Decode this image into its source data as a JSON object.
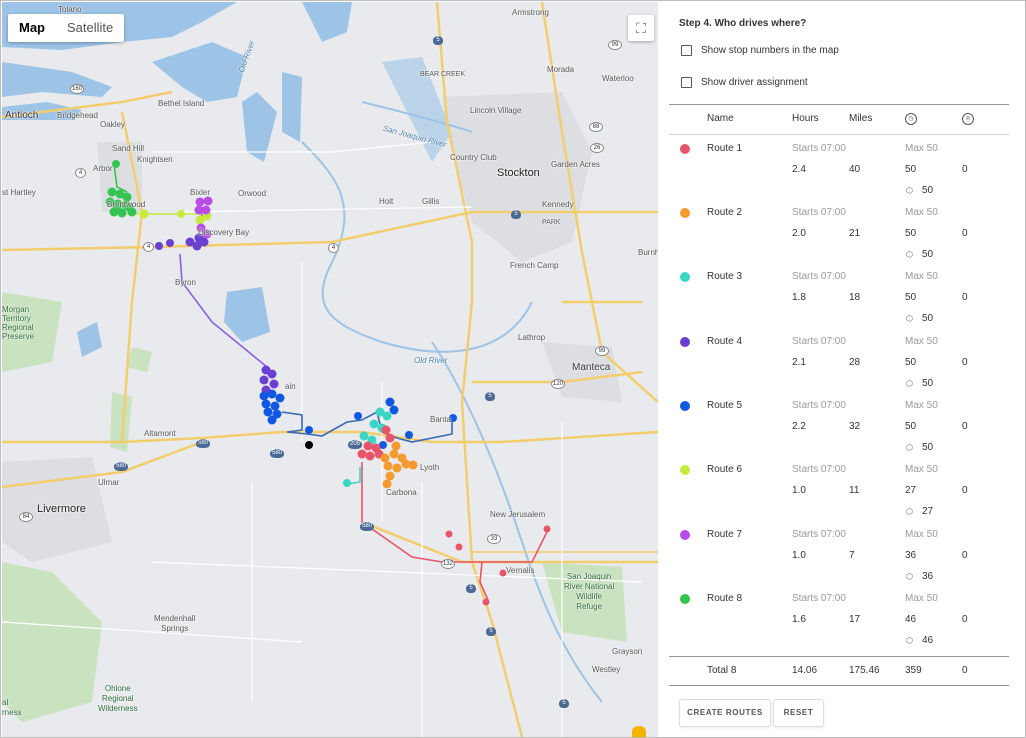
{
  "map": {
    "type_buttons": [
      "Map",
      "Satellite"
    ],
    "active_type": "Map",
    "fullscreen_icon": "⛶",
    "labels": {
      "tolano": "Tolano",
      "armstrong": "Armstrong",
      "morada": "Morada",
      "waterloo": "Waterloo",
      "bear_creek": "BEAR CREEK",
      "antioch": "Antioch",
      "bridgehead": "Bridgehead",
      "oakley": "Oakley",
      "bethel_island": "Bethel Island",
      "lincoln_village": "Lincoln Village",
      "sand_hill": "Sand Hill",
      "knightsen": "Knightsen",
      "arbor": "Arbor",
      "country_club": "Country Club",
      "stockton": "Stockton",
      "garden_acres": "Garden Acres",
      "east_hartley": "st Hartley",
      "brentwood": "Brentwood",
      "bixler": "Bixler",
      "orwood": "Orwood",
      "holt": "Holt",
      "gillis": "Gillis",
      "kennedy": "Kennedy",
      "discovery_bay": "Discovery Bay",
      "park": "PARK",
      "burnham": "Burnh",
      "french_camp": "French Camp",
      "byron": "Byron",
      "morgan_territory": "Morgan\nTerritory\nRegional\nPreserve",
      "lathrop": "Lathrop",
      "old_river": "Old River",
      "manteca": "Manteca",
      "mountain_house": "ain",
      "bantas": "Banta",
      "altamont": "Altamont",
      "lyoth": "Lyoth",
      "carbona": "Carbona",
      "ulmar": "Ulmar",
      "livermore": "Livermore",
      "new_jerusalem": "New Jerusalem",
      "vernalis": "Vernalis",
      "sj_refuge": "San Joaquin\nRiver National\nWildlife\nRefuge",
      "mendenhall": "Mendenhall\nSprings",
      "grayson": "Grayson",
      "westley": "Westley",
      "ohlone": "Ohlone\nRegional\nWilderness",
      "old_river2": "Old River",
      "sjr": "San Joaquin River",
      "hmond": "mond",
      "preserve": "al\nrness"
    },
    "shields": {
      "i5_a": "5",
      "i5_b": "5",
      "i5_c": "5",
      "i5_d": "5",
      "i5_e": "5",
      "i5_f": "5",
      "i580_a": "580",
      "i580_b": "580",
      "i205": "205",
      "i580_c": "580",
      "s4_a": "4",
      "s4_b": "4",
      "s4_c": "4",
      "s4_d": "4",
      "s99_a": "99",
      "s99_b": "99",
      "s99_c": "99",
      "s160": "160",
      "s12": "12",
      "s26": "26",
      "s88": "88",
      "s120": "120",
      "s132": "132",
      "s33": "33",
      "s84": "84",
      "s4e": "4"
    }
  },
  "panel": {
    "step_title": "Step 4. Who drives where?",
    "options": [
      {
        "label": "Show stop numbers in the map",
        "checked": false
      },
      {
        "label": "Show driver assignment",
        "checked": false
      }
    ],
    "columns": {
      "name": "Name",
      "hours": "Hours",
      "miles": "Miles",
      "icon1": "◷",
      "icon2": "℗"
    },
    "routes": [
      {
        "name": "Route 1",
        "color": "#e8546a",
        "starts": "Starts 07:00",
        "max": "Max 50",
        "hours": "2.4",
        "miles": "40",
        "stops": "50",
        "pickups": "0",
        "pkg": "50"
      },
      {
        "name": "Route 2",
        "color": "#f59a2e",
        "starts": "Starts 07:00",
        "max": "Max 50",
        "hours": "2.0",
        "miles": "21",
        "stops": "50",
        "pickups": "0",
        "pkg": "50"
      },
      {
        "name": "Route 3",
        "color": "#3ad6c4",
        "starts": "Starts 07:00",
        "max": "Max 50",
        "hours": "1.8",
        "miles": "18",
        "stops": "50",
        "pickups": "0",
        "pkg": "50"
      },
      {
        "name": "Route 4",
        "color": "#6a3fd1",
        "starts": "Starts 07:00",
        "max": "Max 50",
        "hours": "2.1",
        "miles": "28",
        "stops": "50",
        "pickups": "0",
        "pkg": "50"
      },
      {
        "name": "Route 5",
        "color": "#1158e0",
        "starts": "Starts 07:00",
        "max": "Max 50",
        "hours": "2.2",
        "miles": "32",
        "stops": "50",
        "pickups": "0",
        "pkg": "50"
      },
      {
        "name": "Route 6",
        "color": "#c6ea3e",
        "starts": "Starts 07:00",
        "max": "Max 50",
        "hours": "1.0",
        "miles": "11",
        "stops": "27",
        "pickups": "0",
        "pkg": "27"
      },
      {
        "name": "Route 7",
        "color": "#b84ce8",
        "starts": "Starts 07:00",
        "max": "Max 50",
        "hours": "1.0",
        "miles": "7",
        "stops": "36",
        "pickups": "0",
        "pkg": "36"
      },
      {
        "name": "Route 8",
        "color": "#33c451",
        "starts": "Starts 07:00",
        "max": "Max 50",
        "hours": "1.6",
        "miles": "17",
        "stops": "46",
        "pickups": "0",
        "pkg": "46"
      }
    ],
    "total": {
      "label": "Total 8",
      "hours": "14.06",
      "miles": "175.46",
      "stops": "359",
      "pickups": "0"
    },
    "buttons": {
      "create": "CREATE ROUTES",
      "reset": "RESET"
    },
    "package_icon": "⬡"
  }
}
